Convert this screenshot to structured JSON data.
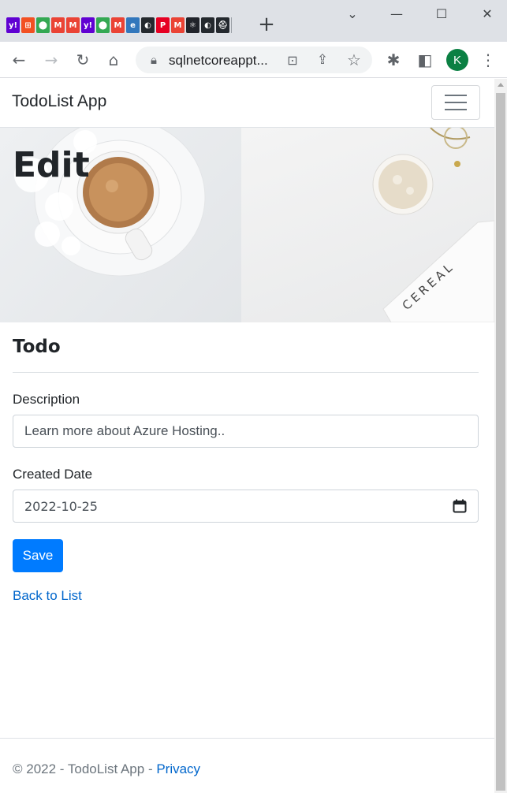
{
  "browser": {
    "tab_favicons": [
      {
        "name": "yahoo-mail-icon",
        "color": "#6001d2",
        "glyph": "y!"
      },
      {
        "name": "microsoft-icon",
        "color": "#f25022",
        "glyph": "⊞"
      },
      {
        "name": "google-maps-icon",
        "color": "#34a853",
        "glyph": "⬤"
      },
      {
        "name": "gmail-icon",
        "color": "#ea4335",
        "glyph": "M"
      },
      {
        "name": "gmail-icon",
        "color": "#ea4335",
        "glyph": "M"
      },
      {
        "name": "yahoo-mail-icon",
        "color": "#6001d2",
        "glyph": "y!"
      },
      {
        "name": "google-maps-icon",
        "color": "#34a853",
        "glyph": "⬤"
      },
      {
        "name": "gmail-icon",
        "color": "#ea4335",
        "glyph": "M"
      },
      {
        "name": "edge-icon",
        "color": "#3277bc",
        "glyph": "e"
      },
      {
        "name": "github-icon",
        "color": "#24292e",
        "glyph": "◐"
      },
      {
        "name": "pinterest-icon",
        "color": "#e60023",
        "glyph": "P"
      },
      {
        "name": "gmail-icon",
        "color": "#ea4335",
        "glyph": "M"
      },
      {
        "name": "react-icon",
        "color": "#20232a",
        "glyph": "⚛"
      },
      {
        "name": "github-icon",
        "color": "#24292e",
        "glyph": "◐"
      },
      {
        "name": "app-icon",
        "color": "#24292e",
        "glyph": "⛑"
      }
    ],
    "new_tab": "+",
    "url": "sqlnetcoreappt...",
    "profile_initial": "K",
    "profile_color": "#0b8043"
  },
  "page": {
    "brand": "TodoList App",
    "hero_title": "Edit",
    "section_title": "Todo",
    "form": {
      "description_label": "Description",
      "description_value": "Learn more about Azure Hosting..",
      "created_date_label": "Created Date",
      "created_date_value": "2022-10-25",
      "save_label": "Save"
    },
    "back_link": "Back to List",
    "footer": {
      "copyright": "© 2022 - TodoList App - ",
      "privacy_link": "Privacy"
    }
  },
  "colors": {
    "primary": "#007bff",
    "link": "#0066cc"
  }
}
